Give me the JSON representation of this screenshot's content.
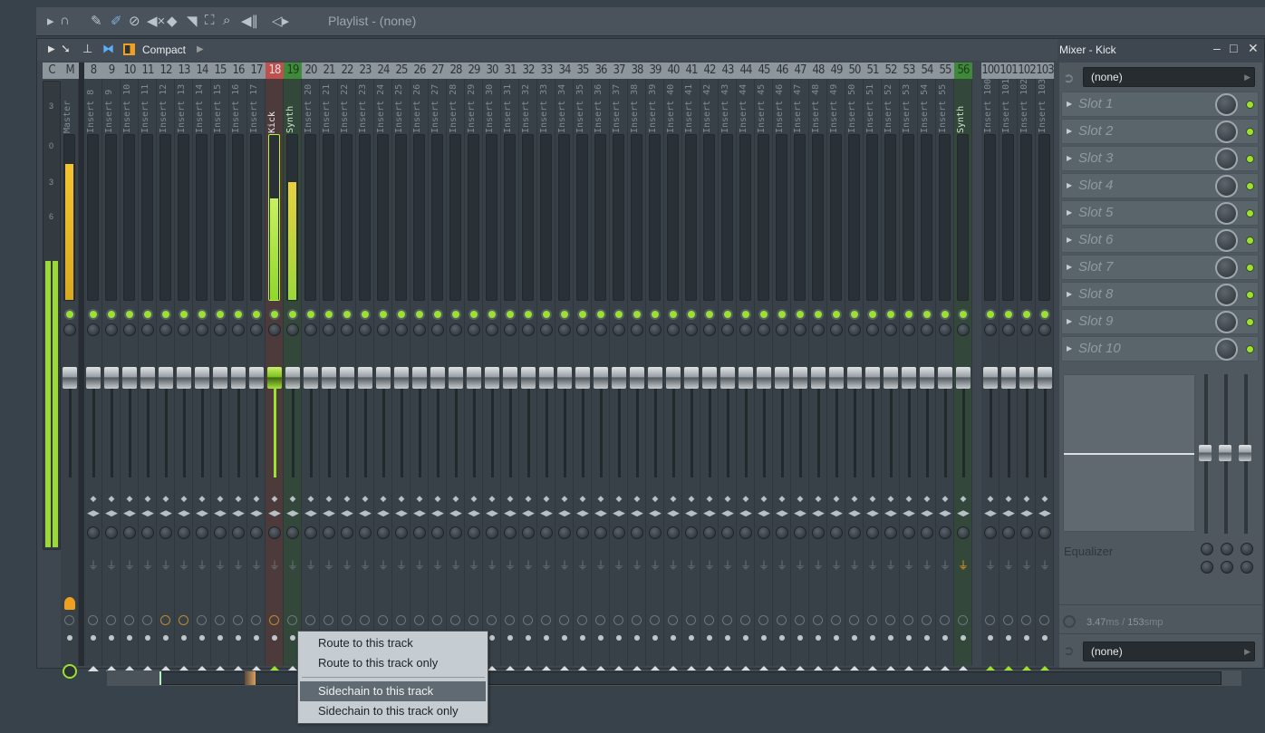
{
  "toolbar": {
    "playlist_label": "Playlist - (none)",
    "icons": [
      "arrow-right-icon",
      "magnet-icon",
      "pencil-icon",
      "paint-icon",
      "delete-icon",
      "mute-icon",
      "slip-icon",
      "slice-icon",
      "select-icon",
      "zoom-icon",
      "playback-icon",
      "speaker-icon"
    ]
  },
  "mixer": {
    "view_label": "Compact",
    "title": "Mixer - Kick",
    "master_headers": [
      "C",
      "M"
    ],
    "master_name": "Master",
    "strips": [
      [
        "8",
        "Insert 8"
      ],
      [
        "9",
        "Insert 9"
      ],
      [
        "10",
        "Insert 10"
      ],
      [
        "11",
        "Insert 11"
      ],
      [
        "12",
        "Insert 12"
      ],
      [
        "13",
        "Insert 13"
      ],
      [
        "14",
        "Insert 14"
      ],
      [
        "15",
        "Insert 15"
      ],
      [
        "16",
        "Insert 16"
      ],
      [
        "17",
        "Insert 17"
      ],
      [
        "18",
        "Kick"
      ],
      [
        "19",
        "Synth"
      ],
      [
        "20",
        "Insert 20"
      ],
      [
        "21",
        "Insert 21"
      ],
      [
        "22",
        "Insert 22"
      ],
      [
        "23",
        "Insert 23"
      ],
      [
        "24",
        "Insert 24"
      ],
      [
        "25",
        "Insert 25"
      ],
      [
        "26",
        "Insert 26"
      ],
      [
        "27",
        "Insert 27"
      ],
      [
        "28",
        "Insert 28"
      ],
      [
        "29",
        "Insert 29"
      ],
      [
        "30",
        "Insert 30"
      ],
      [
        "31",
        "Insert 31"
      ],
      [
        "32",
        "Insert 32"
      ],
      [
        "33",
        "Insert 33"
      ],
      [
        "34",
        "Insert 34"
      ],
      [
        "35",
        "Insert 35"
      ],
      [
        "36",
        "Insert 36"
      ],
      [
        "37",
        "Insert 37"
      ],
      [
        "38",
        "Insert 38"
      ],
      [
        "39",
        "Insert 39"
      ],
      [
        "40",
        "Insert 40"
      ],
      [
        "41",
        "Insert 41"
      ],
      [
        "42",
        "Insert 42"
      ],
      [
        "43",
        "Insert 43"
      ],
      [
        "44",
        "Insert 44"
      ],
      [
        "45",
        "Insert 45"
      ],
      [
        "46",
        "Insert 46"
      ],
      [
        "47",
        "Insert 47"
      ],
      [
        "48",
        "Insert 48"
      ],
      [
        "49",
        "Insert 49"
      ],
      [
        "50",
        "Insert 50"
      ],
      [
        "51",
        "Insert 51"
      ],
      [
        "52",
        "Insert 52"
      ],
      [
        "53",
        "Insert 53"
      ],
      [
        "54",
        "Insert 54"
      ],
      [
        "55",
        "Insert 55"
      ],
      [
        "56",
        "Synth"
      ]
    ],
    "extra_strips": [
      [
        "100",
        "Insert 100"
      ],
      [
        "101",
        "Insert 101"
      ],
      [
        "102",
        "Insert 102"
      ],
      [
        "103",
        "Insert 103"
      ]
    ],
    "selected": "18",
    "meter_scale": [
      "3",
      "0",
      "3",
      "6"
    ],
    "colors": {
      "selected": "#c0504d",
      "routed": "#3f8a3a",
      "meter": "#a8e03a",
      "accent": "#9be22e"
    }
  },
  "panel": {
    "input": "(none)",
    "slots": [
      "Slot 1",
      "Slot 2",
      "Slot 3",
      "Slot 4",
      "Slot 5",
      "Slot 6",
      "Slot 7",
      "Slot 8",
      "Slot 9",
      "Slot 10"
    ],
    "eq_label": "Equalizer",
    "latency_ms": "3.47",
    "latency_ms_unit": "ms / ",
    "latency_smp": "153",
    "latency_smp_unit": "smp",
    "output": "(none)"
  },
  "menu": {
    "items": [
      "Route to this track",
      "Route to this track only",
      "Sidechain to this track",
      "Sidechain to this track only"
    ],
    "highlighted": 2
  }
}
